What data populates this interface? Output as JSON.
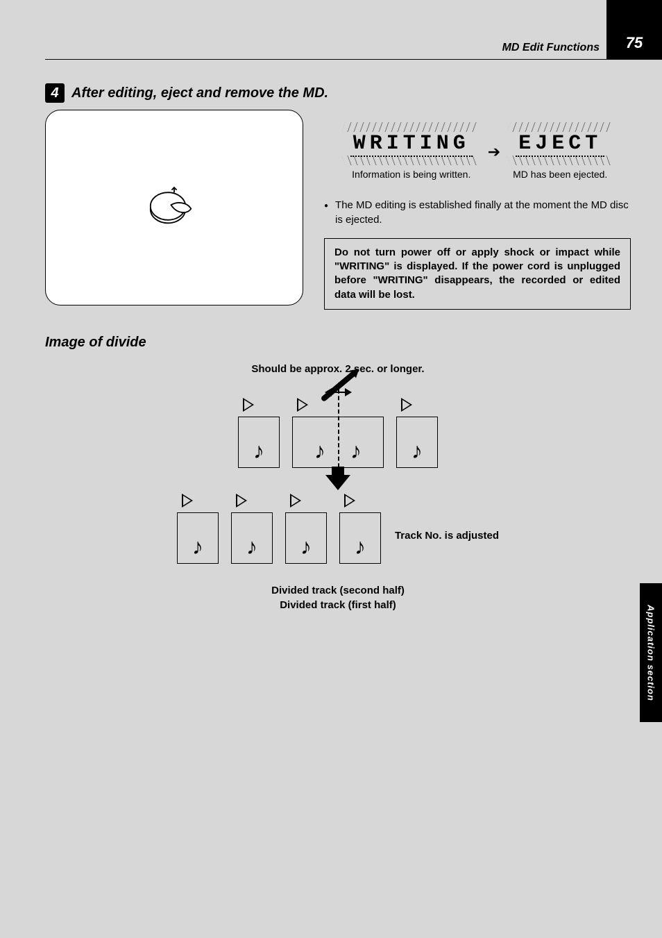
{
  "header": {
    "page_number": "75",
    "section": "MD Edit Functions"
  },
  "step": {
    "number": "4",
    "title": "After editing, eject and remove the MD."
  },
  "display": {
    "writing": "WRITING",
    "writing_caption": "Information is being written.",
    "eject": "EJECT",
    "eject_caption": "MD has been ejected."
  },
  "bullet_text": "The MD editing is established finally at the moment the MD disc is ejected.",
  "warning": "Do not turn power off or apply shock or impact while \"WRITING\" is displayed. If the power cord is unplugged before \"WRITING\" disappears, the recorded or edited data will be lost.",
  "divide": {
    "heading": "Image of divide",
    "top_note": "Should be approx. 2 sec. or longer.",
    "label_adjusted": "Track No. is adjusted",
    "label_second_half": "Divided track (second half)",
    "label_first_half": "Divided track (first half)"
  },
  "side_tab": "Application section"
}
